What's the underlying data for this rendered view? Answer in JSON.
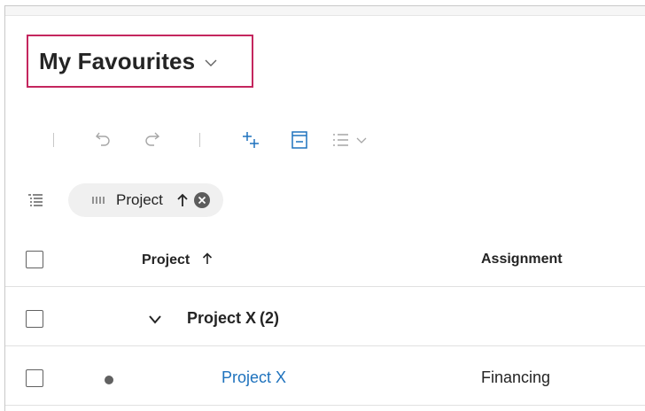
{
  "view": {
    "title": "My Favourites"
  },
  "toolbar": {
    "buttons": [
      {
        "name": "undo-button",
        "icon": "undo-icon"
      },
      {
        "name": "redo-button",
        "icon": "redo-icon"
      },
      {
        "name": "add-button",
        "icon": "add-icon"
      },
      {
        "name": "collapse-button",
        "icon": "collapse-icon"
      },
      {
        "name": "list-options-button",
        "icon": "list-icon"
      }
    ]
  },
  "grouping": {
    "chip_label": "Project",
    "sort_direction": "ascending"
  },
  "table": {
    "columns": [
      {
        "label": "Project",
        "sort": "ascending"
      },
      {
        "label": "Assignment"
      }
    ],
    "group": {
      "label": "Project X",
      "count": "(2)"
    },
    "rows": [
      {
        "project": "Project X",
        "assignment": "Financing"
      }
    ]
  },
  "colors": {
    "accent_border": "#c4265e",
    "link": "#1e72bd",
    "toolbar_icon": "#1e72bd",
    "disabled_icon": "#a6a6a6"
  }
}
